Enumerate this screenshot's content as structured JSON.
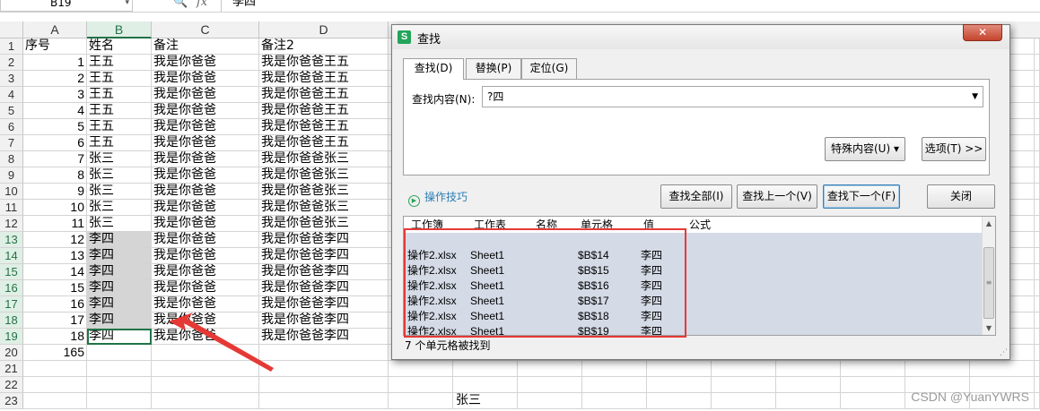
{
  "formula_bar": {
    "cell_ref": "B19",
    "fx_symbol": "fx",
    "zoom_symbol": "🔍",
    "value": "李四"
  },
  "columns": [
    "A",
    "B",
    "C",
    "D"
  ],
  "rows": [
    {
      "n": "1",
      "a": "序号",
      "b": "姓名",
      "c": "备注",
      "d": "备注2"
    },
    {
      "n": "2",
      "a": "1",
      "b": "王五",
      "c": "我是你爸爸",
      "d": "我是你爸爸王五"
    },
    {
      "n": "3",
      "a": "2",
      "b": "王五",
      "c": "我是你爸爸",
      "d": "我是你爸爸王五"
    },
    {
      "n": "4",
      "a": "3",
      "b": "王五",
      "c": "我是你爸爸",
      "d": "我是你爸爸王五"
    },
    {
      "n": "5",
      "a": "4",
      "b": "王五",
      "c": "我是你爸爸",
      "d": "我是你爸爸王五"
    },
    {
      "n": "6",
      "a": "5",
      "b": "王五",
      "c": "我是你爸爸",
      "d": "我是你爸爸王五"
    },
    {
      "n": "7",
      "a": "6",
      "b": "王五",
      "c": "我是你爸爸",
      "d": "我是你爸爸王五"
    },
    {
      "n": "8",
      "a": "7",
      "b": "张三",
      "c": "我是你爸爸",
      "d": "我是你爸爸张三"
    },
    {
      "n": "9",
      "a": "8",
      "b": "张三",
      "c": "我是你爸爸",
      "d": "我是你爸爸张三"
    },
    {
      "n": "10",
      "a": "9",
      "b": "张三",
      "c": "我是你爸爸",
      "d": "我是你爸爸张三"
    },
    {
      "n": "11",
      "a": "10",
      "b": "张三",
      "c": "我是你爸爸",
      "d": "我是你爸爸张三"
    },
    {
      "n": "12",
      "a": "11",
      "b": "张三",
      "c": "我是你爸爸",
      "d": "我是你爸爸张三"
    },
    {
      "n": "13",
      "a": "12",
      "b": "李四",
      "c": "我是你爸爸",
      "d": "我是你爸爸李四"
    },
    {
      "n": "14",
      "a": "13",
      "b": "李四",
      "c": "我是你爸爸",
      "d": "我是你爸爸李四"
    },
    {
      "n": "15",
      "a": "14",
      "b": "李四",
      "c": "我是你爸爸",
      "d": "我是你爸爸李四"
    },
    {
      "n": "16",
      "a": "15",
      "b": "李四",
      "c": "我是你爸爸",
      "d": "我是你爸爸李四"
    },
    {
      "n": "17",
      "a": "16",
      "b": "李四",
      "c": "我是你爸爸",
      "d": "我是你爸爸李四"
    },
    {
      "n": "18",
      "a": "17",
      "b": "李四",
      "c": "我是你爸爸",
      "d": "我是你爸爸李四"
    },
    {
      "n": "19",
      "a": "18",
      "b": "李四",
      "c": "我是你爸爸",
      "d": "我是你爸爸李四"
    },
    {
      "n": "20",
      "a": "165",
      "b": "",
      "c": "",
      "d": ""
    },
    {
      "n": "21",
      "a": "",
      "b": "",
      "c": "",
      "d": ""
    },
    {
      "n": "22",
      "a": "",
      "b": "",
      "c": "",
      "d": ""
    },
    {
      "n": "23",
      "a": "",
      "b": "",
      "c": "",
      "d": "",
      "extra": "张三"
    }
  ],
  "dialog": {
    "title": "查找",
    "logo": "S",
    "close_icon": "✕",
    "tabs": [
      "查找(D)",
      "替换(P)",
      "定位(G)"
    ],
    "find_label": "查找内容(N):",
    "find_value": "?四",
    "special_btn": "特殊内容(U) ▾",
    "options_btn": "选项(T) >>",
    "tips": "操作技巧",
    "find_all": "查找全部(I)",
    "find_prev": "查找上一个(V)",
    "find_next": "查找下一个(F)",
    "close_btn": "关闭",
    "result_headers": [
      "工作簿",
      "工作表",
      "名称",
      "单元格",
      "值",
      "公式"
    ],
    "results": [
      {
        "book": "操作2.xlsx",
        "sheet": "Sheet1",
        "cell": "$B$14",
        "value": "李四"
      },
      {
        "book": "操作2.xlsx",
        "sheet": "Sheet1",
        "cell": "$B$15",
        "value": "李四"
      },
      {
        "book": "操作2.xlsx",
        "sheet": "Sheet1",
        "cell": "$B$16",
        "value": "李四"
      },
      {
        "book": "操作2.xlsx",
        "sheet": "Sheet1",
        "cell": "$B$17",
        "value": "李四"
      },
      {
        "book": "操作2.xlsx",
        "sheet": "Sheet1",
        "cell": "$B$18",
        "value": "李四"
      },
      {
        "book": "操作2.xlsx",
        "sheet": "Sheet1",
        "cell": "$B$19",
        "value": "李四"
      }
    ],
    "status": "7 个单元格被找到"
  },
  "watermark": "CSDN @YuanYWRS",
  "colors": {
    "accent": "#217346",
    "highlight": "#d5d5d5",
    "annotation": "#e53935"
  }
}
